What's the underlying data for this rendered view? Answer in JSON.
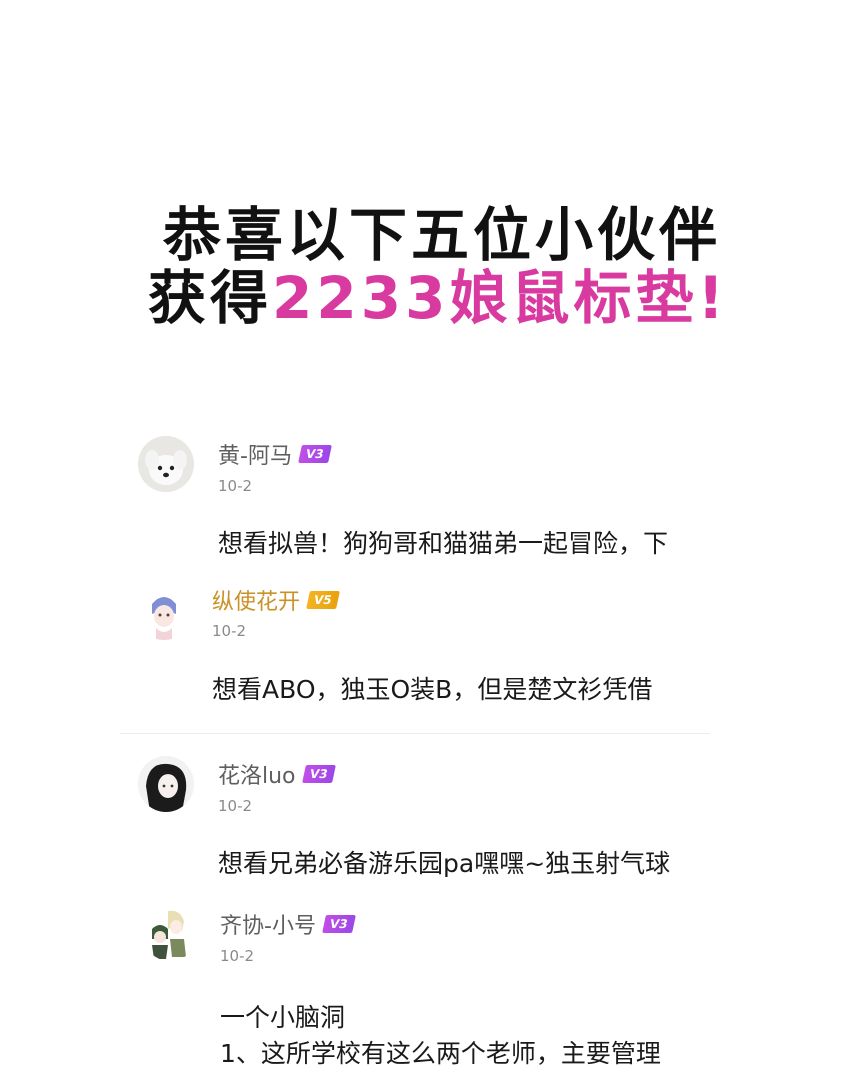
{
  "headline": {
    "line1": "恭喜以下五位小伙伴",
    "line2_prefix": "获得",
    "line2_highlight": "2233娘鼠标垫!",
    "accent_color": "#d93aa0"
  },
  "comments": [
    {
      "username": "黄-阿马",
      "level": "V3",
      "date": "10-2",
      "text": "想看拟兽！狗狗哥和猫猫弟一起冒险，下",
      "avatar": "white-dog-avatar"
    },
    {
      "username": "纵使花开",
      "level": "V5",
      "date": "10-2",
      "text": "想看ABO，独玉O装B，但是楚文衫凭借",
      "avatar": "anime-girl-avatar"
    },
    {
      "username": "花洛luo",
      "level": "V3",
      "date": "10-2",
      "text": "想看兄弟必备游乐园pa嘿嘿~独玉射气球",
      "avatar": "dark-hair-avatar"
    },
    {
      "username": "齐协-小号",
      "level": "V3",
      "date": "10-2",
      "text_line1": "一个小脑洞",
      "text_line2": "1、这所学校有这么两个老师，主要管理",
      "avatar": "anime-duo-avatar"
    }
  ]
}
